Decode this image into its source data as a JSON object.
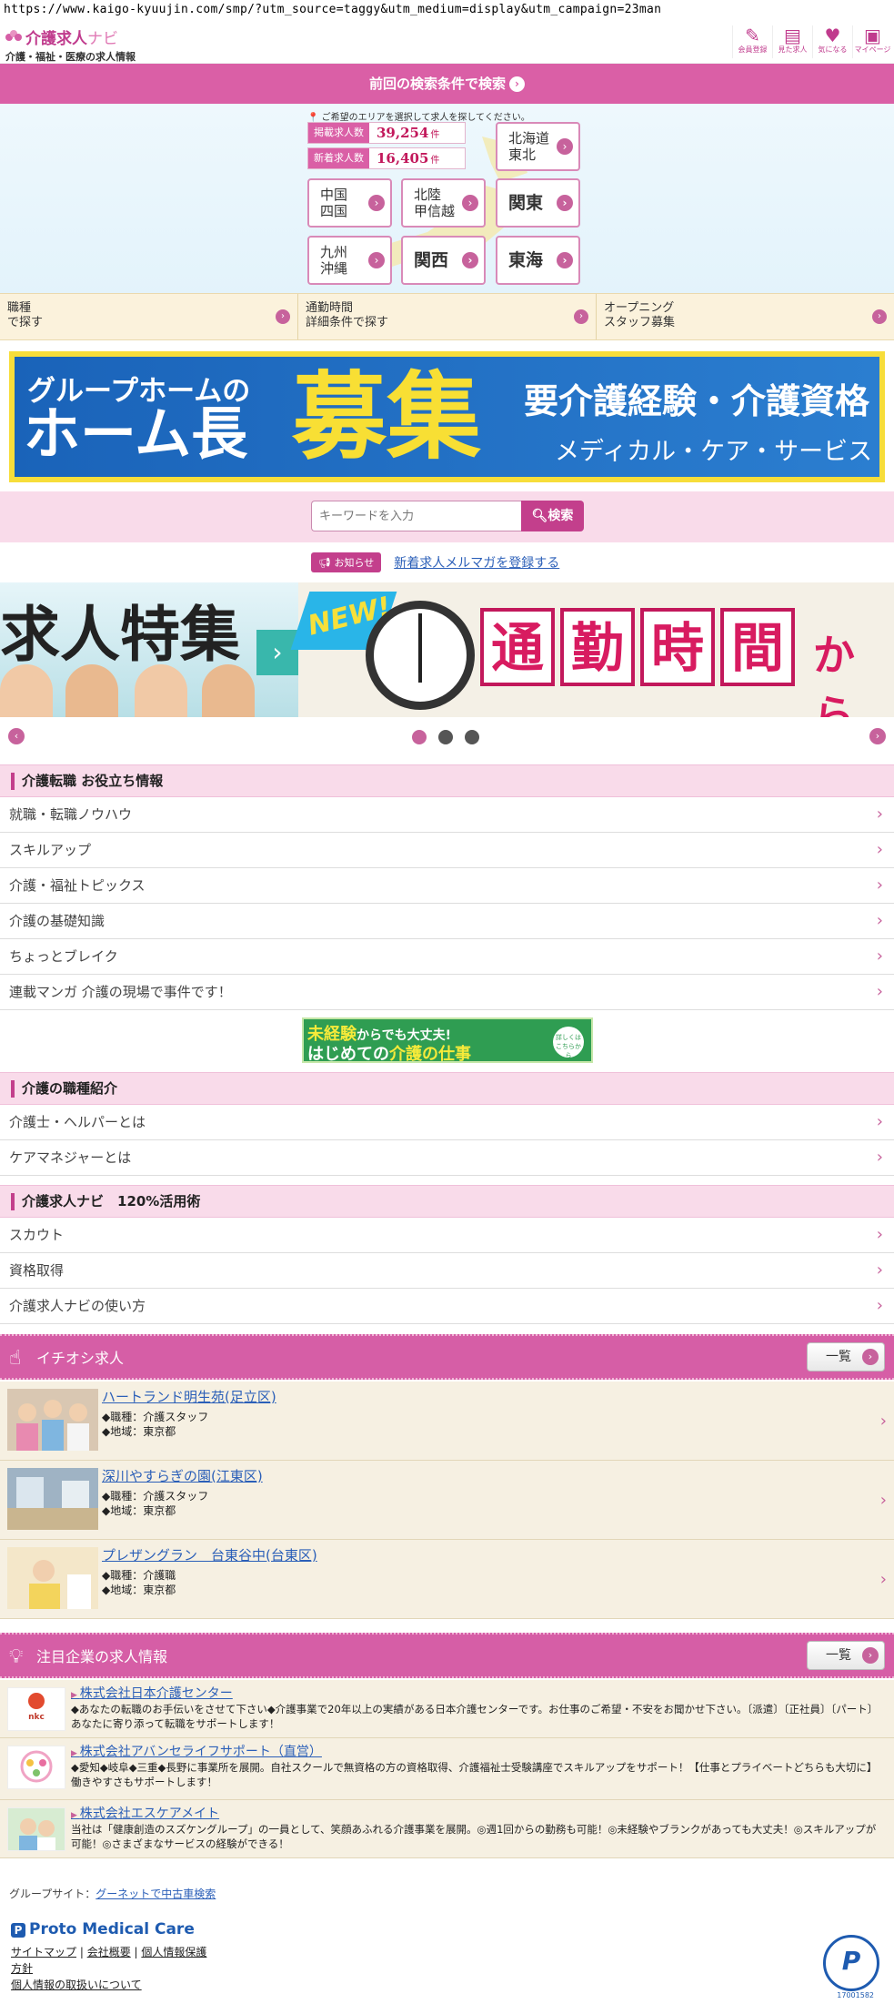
{
  "browser": {
    "url": "https://www.kaigo-kyuujin.com/smp/?utm_source=taggy&utm_medium=display&utm_campaign=23man"
  },
  "header": {
    "logo_main": "介護求人",
    "logo_accent": "ナビ",
    "logo_sub": "介護・福祉・医療の求人情報",
    "icons": [
      {
        "icon": "pencil-icon",
        "label": "会員登録"
      },
      {
        "icon": "history-icon",
        "label": "見た求人"
      },
      {
        "icon": "heart-icon",
        "label": "気になる"
      },
      {
        "icon": "mypage-icon",
        "label": "マイページ"
      }
    ]
  },
  "prev_search": {
    "label": "前回の検索条件で検索"
  },
  "area": {
    "note": "ご希望のエリアを選択して求人を探してください。",
    "stats": [
      {
        "label": "掲載求人数",
        "value": "39,254",
        "unit": "件"
      },
      {
        "label": "新着求人数",
        "value": "16,405",
        "unit": "件"
      }
    ],
    "regions": [
      {
        "line1": "北海道",
        "line2": "東北"
      },
      {
        "line1": "中国",
        "line2": "四国"
      },
      {
        "line1": "北陸",
        "line2": "甲信越"
      },
      {
        "line1": "関東",
        "line2": ""
      },
      {
        "line1": "九州",
        "line2": "沖縄"
      },
      {
        "line1": "関西",
        "line2": ""
      },
      {
        "line1": "東海",
        "line2": ""
      }
    ]
  },
  "search_options": [
    {
      "line1": "職種",
      "line2": "で探す"
    },
    {
      "line1": "通勤時間",
      "line2": "詳細条件で探す"
    },
    {
      "line1": "オープニング",
      "line2": "スタッフ募集"
    }
  ],
  "banner": {
    "line1": "グループホームの",
    "line2": "ホーム長",
    "big": "募集",
    "req": "要介護経験・介護資格",
    "company": "メディカル・ケア・サービス"
  },
  "keyword": {
    "placeholder": "キーワードを入力",
    "button": "検索"
  },
  "notice": {
    "badge": "お知らせ",
    "link": "新着求人メルマガを登録する"
  },
  "carousel": {
    "slide1_title": "求人特集",
    "slide2_new": "NEW!",
    "slide2_chars": [
      "通",
      "勤",
      "時",
      "間"
    ],
    "slide2_tail": "から"
  },
  "sections": {
    "tips": {
      "title": "介護転職 お役立ち情報",
      "items": [
        "就職・転職ノウハウ",
        "スキルアップ",
        "介護・福祉トピックス",
        "介護の基礎知識",
        "ちょっとブレイク",
        "連載マンガ 介護の現場で事件です！"
      ]
    },
    "mini_banner": {
      "l1a": "未経験",
      "l1b": "からでも大丈夫!",
      "l2a": "はじめての",
      "l2b": "介護の仕事",
      "badge": "詳しくは こちらから"
    },
    "jobtypes": {
      "title": "介護の職種紹介",
      "items": [
        "介護士・ヘルパーとは",
        "ケアマネジャーとは"
      ]
    },
    "howto": {
      "title": "介護求人ナビ　120%活用術",
      "items": [
        "スカウト",
        "資格取得",
        "介護求人ナビの使い方"
      ]
    }
  },
  "pickup": {
    "title": "イチオシ求人",
    "list_btn": "一覧",
    "jobs": [
      {
        "name": "ハートランド明生苑(足立区)",
        "type": "◆職種：介護スタッフ",
        "area": "◆地域：東京都"
      },
      {
        "name": "深川やすらぎの園(江東区)",
        "type": "◆職種：介護スタッフ",
        "area": "◆地域：東京都"
      },
      {
        "name": "プレザングラン　台東谷中(台東区)",
        "type": "◆職種：介護職",
        "area": "◆地域：東京都"
      }
    ]
  },
  "featured": {
    "title": "注目企業の求人情報",
    "list_btn": "一覧",
    "companies": [
      {
        "name": "株式会社日本介護センター",
        "logo": "nkc",
        "desc": "◆あなたの転職のお手伝いをさせて下さい◆介護事業で20年以上の実績がある日本介護センターです。お仕事のご希望・不安をお聞かせ下さい。〔派遣〕〔正社員〕〔パート〕あなたに寄り添って転職をサポートします！"
      },
      {
        "name": "株式会社アバンセライフサポート（直営）",
        "logo": "",
        "desc": "◆愛知◆岐阜◆三重◆長野に事業所を展開。自社スクールで無資格の方の資格取得、介護福祉士受験講座でスキルアップをサポート！【仕事とプライベートどちらも大切に】働きやすさもサポートします！"
      },
      {
        "name": "株式会社エスケアメイト",
        "logo": "",
        "desc": "当社は「健康創造のスズケングループ」の一員として、笑顔あふれる介護事業を展開。◎週1回からの勤務も可能！◎未経験やブランクがあっても大丈夫！◎スキルアップが可能！◎さまざまなサービスの経験ができる！"
      }
    ]
  },
  "footer": {
    "group_label": "グループサイト：",
    "group_link": "グーネットで中古車検索",
    "brand": "Proto Medical Care",
    "links_row1": [
      "サイトマップ",
      "会社概要",
      "個人情報保護"
    ],
    "links_row2": "方針",
    "links_row3": "個人情報の取扱いについて",
    "pmark_num": "17001582"
  },
  "colors": {
    "accent": "#d65ea6",
    "link": "#2b5fb8"
  }
}
